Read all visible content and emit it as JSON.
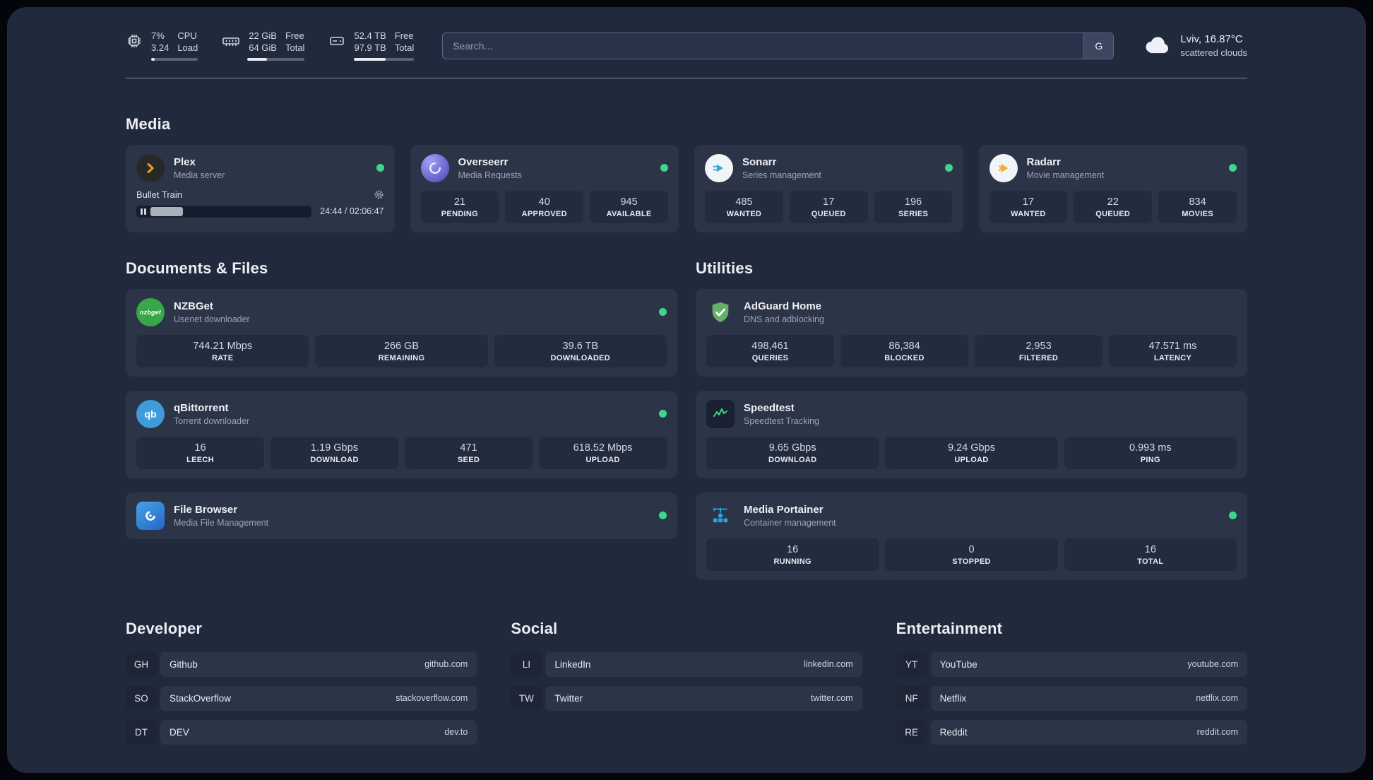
{
  "colors": {
    "panel_bg": "#212a3c",
    "card_bg": "#2c3548",
    "stat_bg": "#232c3e",
    "status_online": "#3ed68e",
    "plex_gold": "#e5a00d",
    "overseerr_purple": "#5a52c7",
    "sonarr_blue": "#2ea7dc",
    "radarr_amber": "#f7a833",
    "nzbget_green": "#37a74a",
    "qbittorrent_blue": "#3f9bd9",
    "filebrowser_blue": "#2f7fd6",
    "adguard_green": "#63b168",
    "speedtest_green": "#3bdb7f",
    "portainer_blue": "#2aa9e0"
  },
  "topbar": {
    "cpu": {
      "value1": "7%",
      "value2": "3.24",
      "label1": "CPU",
      "label2": "Load",
      "bar_percent": 7
    },
    "memory": {
      "value1": "22 GiB",
      "value2": "64 GiB",
      "label1": "Free",
      "label2": "Total",
      "bar_percent": 34
    },
    "disk": {
      "value1": "52.4 TB",
      "value2": "97.9 TB",
      "label1": "Free",
      "label2": "Total",
      "bar_percent": 53
    },
    "search": {
      "placeholder": "Search...",
      "provider_label": "G"
    },
    "weather": {
      "location": "Lviv, 16.87°C",
      "condition": "scattered clouds"
    }
  },
  "sections": {
    "media": {
      "title": "Media",
      "cards": [
        {
          "name": "Plex",
          "desc": "Media server",
          "status": "online",
          "player": {
            "title": "Bullet Train",
            "time": "24:44 / 02:06:47",
            "progress_percent": 19
          }
        },
        {
          "name": "Overseerr",
          "desc": "Media Requests",
          "status": "online",
          "stats": [
            {
              "value": "21",
              "label": "PENDING"
            },
            {
              "value": "40",
              "label": "APPROVED"
            },
            {
              "value": "945",
              "label": "AVAILABLE"
            }
          ]
        },
        {
          "name": "Sonarr",
          "desc": "Series management",
          "status": "online",
          "stats": [
            {
              "value": "485",
              "label": "WANTED"
            },
            {
              "value": "17",
              "label": "QUEUED"
            },
            {
              "value": "196",
              "label": "SERIES"
            }
          ]
        },
        {
          "name": "Radarr",
          "desc": "Movie management",
          "status": "online",
          "stats": [
            {
              "value": "17",
              "label": "WANTED"
            },
            {
              "value": "22",
              "label": "QUEUED"
            },
            {
              "value": "834",
              "label": "MOVIES"
            }
          ]
        }
      ]
    },
    "documents": {
      "title": "Documents & Files",
      "cards": [
        {
          "name": "NZBGet",
          "desc": "Usenet downloader",
          "status": "online",
          "stats": [
            {
              "value": "744.21 Mbps",
              "label": "RATE"
            },
            {
              "value": "266 GB",
              "label": "REMAINING"
            },
            {
              "value": "39.6 TB",
              "label": "DOWNLOADED"
            }
          ]
        },
        {
          "name": "qBittorrent",
          "desc": "Torrent downloader",
          "status": "online",
          "stats": [
            {
              "value": "16",
              "label": "LEECH"
            },
            {
              "value": "1.19 Gbps",
              "label": "DOWNLOAD"
            },
            {
              "value": "471",
              "label": "SEED"
            },
            {
              "value": "618.52 Mbps",
              "label": "UPLOAD"
            }
          ]
        },
        {
          "name": "File Browser",
          "desc": "Media File Management",
          "status": "online",
          "stats": []
        }
      ]
    },
    "utilities": {
      "title": "Utilities",
      "cards": [
        {
          "name": "AdGuard Home",
          "desc": "DNS and adblocking",
          "stats": [
            {
              "value": "498,461",
              "label": "QUERIES"
            },
            {
              "value": "86,384",
              "label": "BLOCKED"
            },
            {
              "value": "2,953",
              "label": "FILTERED"
            },
            {
              "value": "47.571 ms",
              "label": "LATENCY"
            }
          ]
        },
        {
          "name": "Speedtest",
          "desc": "Speedtest Tracking",
          "stats": [
            {
              "value": "9.65 Gbps",
              "label": "DOWNLOAD"
            },
            {
              "value": "9.24 Gbps",
              "label": "UPLOAD"
            },
            {
              "value": "0.993 ms",
              "label": "PING"
            }
          ]
        },
        {
          "name": "Media Portainer",
          "desc": "Container management",
          "status": "online",
          "stats": [
            {
              "value": "16",
              "label": "RUNNING"
            },
            {
              "value": "0",
              "label": "STOPPED"
            },
            {
              "value": "16",
              "label": "TOTAL"
            }
          ]
        }
      ]
    },
    "bookmarks": [
      {
        "title": "Developer",
        "items": [
          {
            "abbr": "GH",
            "name": "Github",
            "url": "github.com"
          },
          {
            "abbr": "SO",
            "name": "StackOverflow",
            "url": "stackoverflow.com"
          },
          {
            "abbr": "DT",
            "name": "DEV",
            "url": "dev.to"
          }
        ]
      },
      {
        "title": "Social",
        "items": [
          {
            "abbr": "LI",
            "name": "LinkedIn",
            "url": "linkedin.com"
          },
          {
            "abbr": "TW",
            "name": "Twitter",
            "url": "twitter.com"
          }
        ]
      },
      {
        "title": "Entertainment",
        "items": [
          {
            "abbr": "YT",
            "name": "YouTube",
            "url": "youtube.com"
          },
          {
            "abbr": "NF",
            "name": "Netflix",
            "url": "netflix.com"
          },
          {
            "abbr": "RE",
            "name": "Reddit",
            "url": "reddit.com"
          }
        ]
      }
    ]
  }
}
